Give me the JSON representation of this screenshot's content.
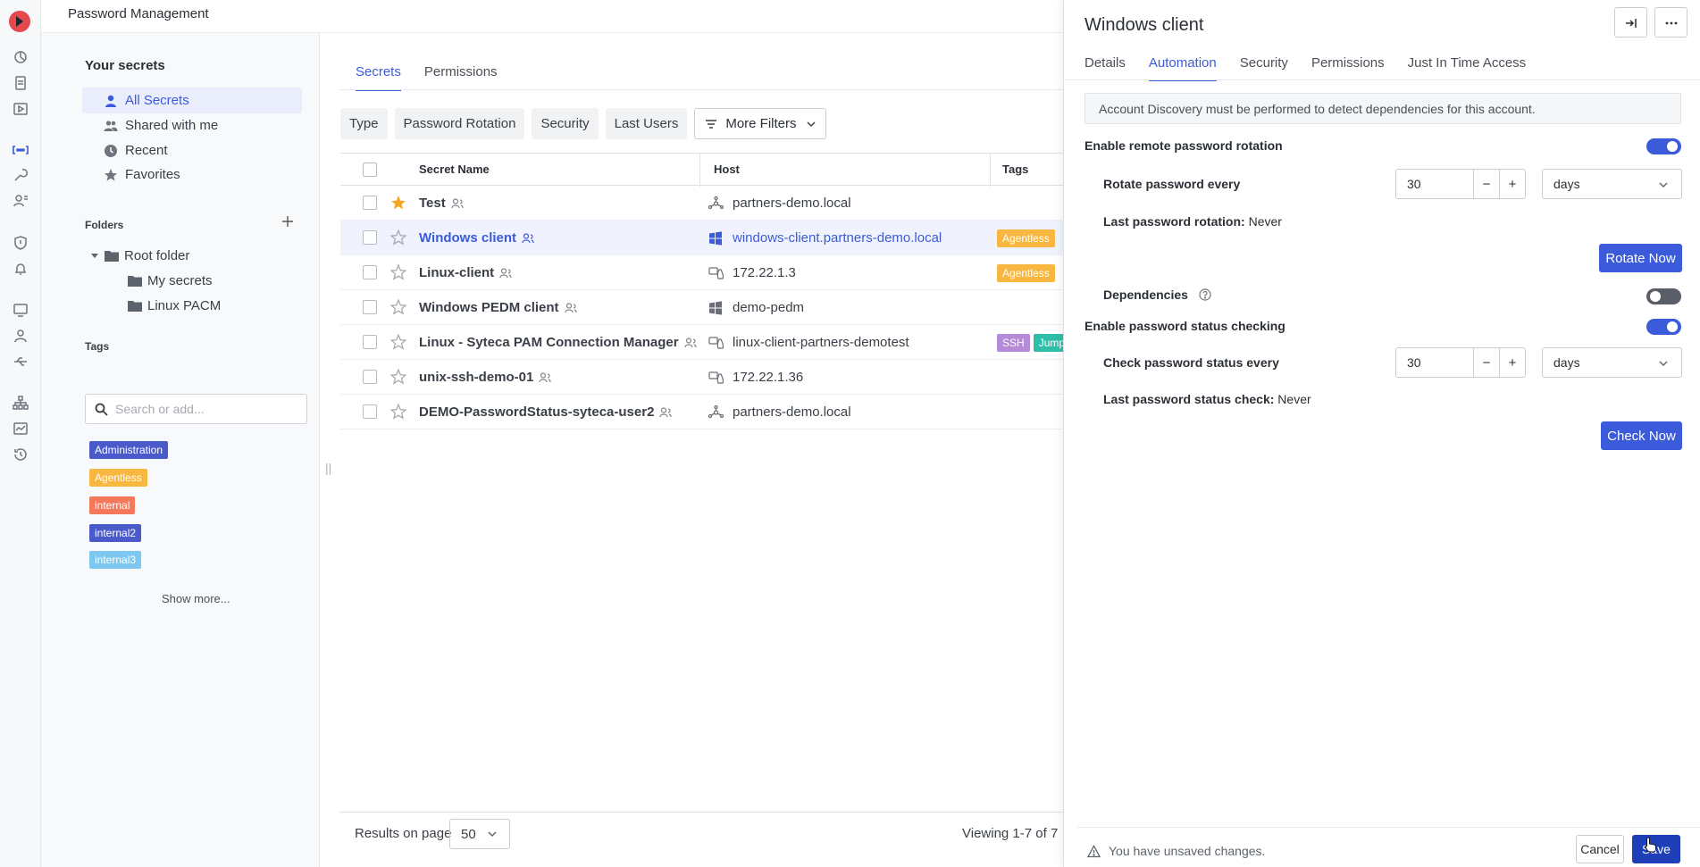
{
  "app": {
    "title": "Password Management"
  },
  "sidebar": {
    "heading": "Your secrets",
    "nav": [
      {
        "label": "All Secrets",
        "icon": "user-icon"
      },
      {
        "label": "Shared with me",
        "icon": "users-icon"
      },
      {
        "label": "Recent",
        "icon": "clock-icon"
      },
      {
        "label": "Favorites",
        "icon": "star-icon"
      }
    ],
    "folders_label": "Folders",
    "folders": [
      {
        "label": "Root folder"
      },
      {
        "label": "My secrets"
      },
      {
        "label": "Linux PACM"
      }
    ],
    "tags_label": "Tags",
    "tag_search_placeholder": "Search or add...",
    "tags": [
      {
        "label": "Administration",
        "color": "#4a5bc9"
      },
      {
        "label": "Agentless",
        "color": "#f7b740"
      },
      {
        "label": "internal",
        "color": "#f4795b"
      },
      {
        "label": "internal2",
        "color": "#4a5bc9"
      },
      {
        "label": "internal3",
        "color": "#7cc8f0"
      }
    ],
    "show_more": "Show more..."
  },
  "main": {
    "tabs": [
      {
        "label": "Secrets"
      },
      {
        "label": "Permissions"
      }
    ],
    "filters": [
      {
        "label": "Type"
      },
      {
        "label": "Password Rotation"
      },
      {
        "label": "Security"
      },
      {
        "label": "Last Users"
      }
    ],
    "more_filters": "More Filters",
    "columns": {
      "name": "Secret Name",
      "host": "Host",
      "tags": "Tags"
    },
    "rows": [
      {
        "name": "Test",
        "host": "partners-demo.local",
        "host_icon": "network-icon",
        "favorite": true,
        "tags": []
      },
      {
        "name": "Windows client",
        "host": "windows-client.partners-demo.local",
        "host_icon": "windows-icon",
        "favorite": false,
        "tags": [
          {
            "label": "Agentless",
            "color": "#f7b740"
          }
        ]
      },
      {
        "name": "Linux-client",
        "host": "172.22.1.3",
        "host_icon": "linux-ssh-icon",
        "favorite": false,
        "tags": [
          {
            "label": "Agentless",
            "color": "#f7b740"
          }
        ]
      },
      {
        "name": "Windows PEDM client",
        "host": "demo-pedm",
        "host_icon": "windows-icon",
        "favorite": false,
        "tags": []
      },
      {
        "name": "Linux - Syteca PAM Connection Manager",
        "host": "linux-client-partners-demotest",
        "host_icon": "linux-ssh-icon",
        "favorite": false,
        "tags": [
          {
            "label": "SSH",
            "color": "#b58ad6"
          },
          {
            "label": "Jump",
            "color": "#2fbfa8"
          }
        ]
      },
      {
        "name": "unix-ssh-demo-01",
        "host": "172.22.1.36",
        "host_icon": "linux-ssh-icon",
        "favorite": false,
        "tags": []
      },
      {
        "name": "DEMO-PasswordStatus-syteca-user2",
        "host": "partners-demo.local",
        "host_icon": "network-icon",
        "favorite": false,
        "tags": []
      }
    ],
    "results_label": "Results on page",
    "results_value": "50",
    "viewing": "Viewing 1-7 of 7"
  },
  "panel": {
    "title": "Windows client",
    "tabs": [
      {
        "label": "Details"
      },
      {
        "label": "Automation"
      },
      {
        "label": "Security"
      },
      {
        "label": "Permissions"
      },
      {
        "label": "Just In Time Access"
      }
    ],
    "notice": "Account Discovery must be performed to detect dependencies for this account.",
    "rotation": {
      "enable_label": "Enable remote password rotation",
      "every_label": "Rotate password every",
      "value": "30",
      "unit": "days",
      "last_label": "Last password rotation:",
      "last_value": "Never",
      "button": "Rotate Now"
    },
    "dependencies_label": "Dependencies",
    "status": {
      "enable_label": "Enable password status checking",
      "every_label": "Check password status every",
      "value": "30",
      "unit": "days",
      "last_label": "Last password status check:",
      "last_value": "Never",
      "button": "Check Now"
    },
    "unsaved": "You have unsaved changes.",
    "cancel": "Cancel",
    "save": "Save",
    "minus": "−",
    "plus": "+"
  }
}
